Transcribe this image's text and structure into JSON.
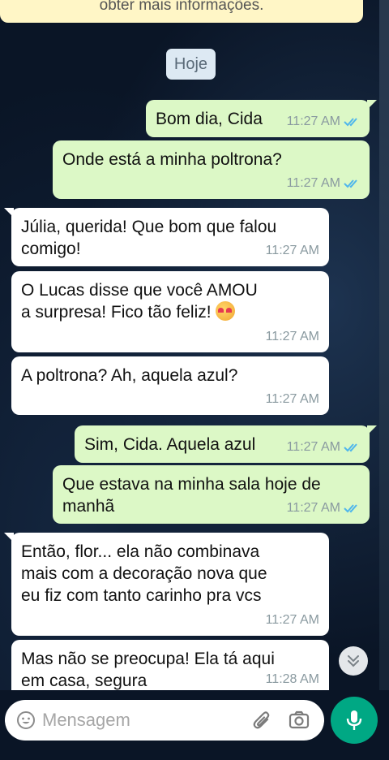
{
  "system_notice": "obter mais informações.",
  "date_chip": "Hoje",
  "messages": [
    {
      "dir": "out",
      "text": "Bom dia, Cida",
      "time": "11:27 AM"
    },
    {
      "dir": "out",
      "text": "Onde está a minha poltrona?",
      "time": "11:27 AM"
    },
    {
      "dir": "in",
      "text": "Júlia, querida! Que bom que falou\ncomigo!",
      "time": "11:27 AM"
    },
    {
      "dir": "in",
      "text": "O Lucas disse que você AMOU\na surpresa! Fico tão feliz! ",
      "time": "11:27 AM",
      "emoji": "smiling-face-with-hearts"
    },
    {
      "dir": "in",
      "text": "A poltrona? Ah, aquela azul?",
      "time": "11:27 AM"
    },
    {
      "dir": "out",
      "text": "Sim, Cida. Aquela azul",
      "time": "11:27 AM"
    },
    {
      "dir": "out",
      "text": "Que estava na minha sala hoje de\nmanhã",
      "time": "11:27 AM"
    },
    {
      "dir": "in",
      "text": "Então, flor... ela não combinava\nmais com a decoração nova que\neu fiz com tanto carinho pra vcs",
      "time": "11:27 AM"
    },
    {
      "dir": "in",
      "text": "Mas não se preocupa! Ela tá aqui\nem casa, segura",
      "time": "11:28 AM"
    }
  ],
  "composer": {
    "placeholder": "Mensagem"
  },
  "icons": {
    "emoji": "emoji-icon",
    "attach": "paperclip-icon",
    "camera": "camera-icon",
    "mic": "mic-icon",
    "scroll": "chevron-double-down-icon",
    "read": "double-check-icon"
  },
  "colors": {
    "outgoing_bubble": "#dcf8c6",
    "incoming_bubble": "#ffffff",
    "read_ticks": "#4fb6ec",
    "mic_button": "#00a884",
    "date_chip": "#dde9f3",
    "notice": "#fff6c6"
  }
}
